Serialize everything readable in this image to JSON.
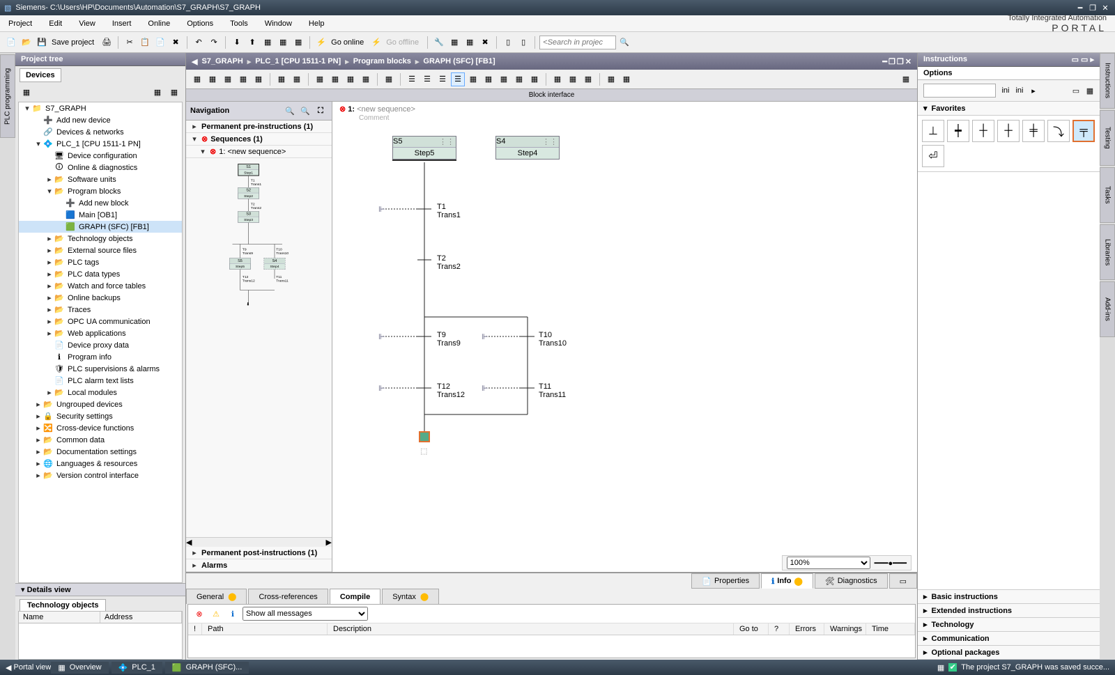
{
  "titlebar": {
    "appname": "Siemens",
    "path": " -  C:\\Users\\HP\\Documents\\Automation\\S7_GRAPH\\S7_GRAPH"
  },
  "menus": [
    "Project",
    "Edit",
    "View",
    "Insert",
    "Online",
    "Options",
    "Tools",
    "Window",
    "Help"
  ],
  "tia": {
    "line1": "Totally Integrated Automation",
    "line2": "PORTAL"
  },
  "toolbar": {
    "save_label": "Save project",
    "go_online": "Go online",
    "go_offline": "Go offline",
    "search_placeholder": "<Search in project>"
  },
  "projecttree": {
    "title": "Project tree",
    "tab": "Devices",
    "items": [
      {
        "d": 0,
        "t": "▾",
        "i": "📁",
        "l": "S7_GRAPH"
      },
      {
        "d": 1,
        "t": "",
        "i": "➕",
        "l": "Add new device"
      },
      {
        "d": 1,
        "t": "",
        "i": "🔗",
        "l": "Devices & networks"
      },
      {
        "d": 1,
        "t": "▾",
        "i": "💠",
        "l": "PLC_1 [CPU 1511-1 PN]"
      },
      {
        "d": 2,
        "t": "",
        "i": "🖥",
        "l": "Device configuration"
      },
      {
        "d": 2,
        "t": "",
        "i": "🛈",
        "l": "Online & diagnostics"
      },
      {
        "d": 2,
        "t": "▸",
        "i": "📂",
        "l": "Software units"
      },
      {
        "d": 2,
        "t": "▾",
        "i": "📂",
        "l": "Program blocks"
      },
      {
        "d": 3,
        "t": "",
        "i": "➕",
        "l": "Add new block"
      },
      {
        "d": 3,
        "t": "",
        "i": "🟦",
        "l": "Main [OB1]"
      },
      {
        "d": 3,
        "t": "",
        "i": "🟩",
        "l": "GRAPH (SFC) [FB1]",
        "sel": true
      },
      {
        "d": 2,
        "t": "▸",
        "i": "📂",
        "l": "Technology objects"
      },
      {
        "d": 2,
        "t": "▸",
        "i": "📂",
        "l": "External source files"
      },
      {
        "d": 2,
        "t": "▸",
        "i": "📂",
        "l": "PLC tags"
      },
      {
        "d": 2,
        "t": "▸",
        "i": "📂",
        "l": "PLC data types"
      },
      {
        "d": 2,
        "t": "▸",
        "i": "📂",
        "l": "Watch and force tables"
      },
      {
        "d": 2,
        "t": "▸",
        "i": "📂",
        "l": "Online backups"
      },
      {
        "d": 2,
        "t": "▸",
        "i": "📂",
        "l": "Traces"
      },
      {
        "d": 2,
        "t": "▸",
        "i": "📂",
        "l": "OPC UA communication"
      },
      {
        "d": 2,
        "t": "▸",
        "i": "📂",
        "l": "Web applications"
      },
      {
        "d": 2,
        "t": "",
        "i": "📄",
        "l": "Device proxy data"
      },
      {
        "d": 2,
        "t": "",
        "i": "ℹ",
        "l": "Program info"
      },
      {
        "d": 2,
        "t": "",
        "i": "🛡",
        "l": "PLC supervisions & alarms"
      },
      {
        "d": 2,
        "t": "",
        "i": "📄",
        "l": "PLC alarm text lists"
      },
      {
        "d": 2,
        "t": "▸",
        "i": "📂",
        "l": "Local modules"
      },
      {
        "d": 1,
        "t": "▸",
        "i": "📂",
        "l": "Ungrouped devices"
      },
      {
        "d": 1,
        "t": "▸",
        "i": "🔒",
        "l": "Security settings"
      },
      {
        "d": 1,
        "t": "▸",
        "i": "🔀",
        "l": "Cross-device functions"
      },
      {
        "d": 1,
        "t": "▸",
        "i": "📂",
        "l": "Common data"
      },
      {
        "d": 1,
        "t": "▸",
        "i": "📂",
        "l": "Documentation settings"
      },
      {
        "d": 1,
        "t": "▸",
        "i": "🌐",
        "l": "Languages & resources"
      },
      {
        "d": 1,
        "t": "▸",
        "i": "📂",
        "l": "Version control interface"
      }
    ]
  },
  "detailsview": {
    "title": "Details view",
    "tab": "Technology objects",
    "col1": "Name",
    "col2": "Address"
  },
  "breadcrumb": [
    "S7_GRAPH",
    "PLC_1 [CPU 1511-1 PN]",
    "Program blocks",
    "GRAPH (SFC) [FB1]"
  ],
  "blockif": "Block interface",
  "navigation": {
    "title": "Navigation",
    "rows": [
      "Permanent pre-instructions (1)",
      "Sequences (1)",
      "1: <new sequence>"
    ],
    "post": "Permanent post-instructions (1)",
    "alarms": "Alarms"
  },
  "sequence": {
    "id": "1:",
    "name": "<new sequence>",
    "comment": "Comment"
  },
  "steps": {
    "s1": {
      "id": "S1",
      "name": "Step1"
    },
    "s2": {
      "id": "S2",
      "name": "Step2"
    },
    "s3": {
      "id": "S3",
      "name": "Step3"
    },
    "s4": {
      "id": "S4",
      "name": "Step4"
    },
    "s5": {
      "id": "S5",
      "name": "Step5"
    }
  },
  "trans": {
    "t1": {
      "id": "T1",
      "name": "Trans1"
    },
    "t2": {
      "id": "T2",
      "name": "Trans2"
    },
    "t9": {
      "id": "T9",
      "name": "Trans9"
    },
    "t10": {
      "id": "T10",
      "name": "Trans10"
    },
    "t11": {
      "id": "T11",
      "name": "Trans11"
    },
    "t12": {
      "id": "T12",
      "name": "Trans12"
    }
  },
  "zoom": "100%",
  "outtabs": {
    "general": "General",
    "xref": "Cross-references",
    "compile": "Compile",
    "syntax": "Syntax"
  },
  "outright": {
    "prop": "Properties",
    "info": "Info",
    "diag": "Diagnostics"
  },
  "outfilter": "Show all messages",
  "outcols": {
    "path": "Path",
    "desc": "Description",
    "goto": "Go to",
    "q": "?",
    "err": "Errors",
    "warn": "Warnings",
    "time": "Time"
  },
  "instr": {
    "title": "Instructions",
    "options": "Options",
    "favorites": "Favorites",
    "cats": [
      "Basic instructions",
      "Extended instructions",
      "Technology",
      "Communication",
      "Optional packages"
    ]
  },
  "rrail": [
    "Instructions",
    "Testing",
    "Tasks",
    "Libraries",
    "Add-ins"
  ],
  "lrail": "PLC programming",
  "status": {
    "portal": "Portal view",
    "overview": "Overview",
    "plc": "PLC_1",
    "graph": "GRAPH (SFC)...",
    "msg": "The project S7_GRAPH was saved succe..."
  }
}
